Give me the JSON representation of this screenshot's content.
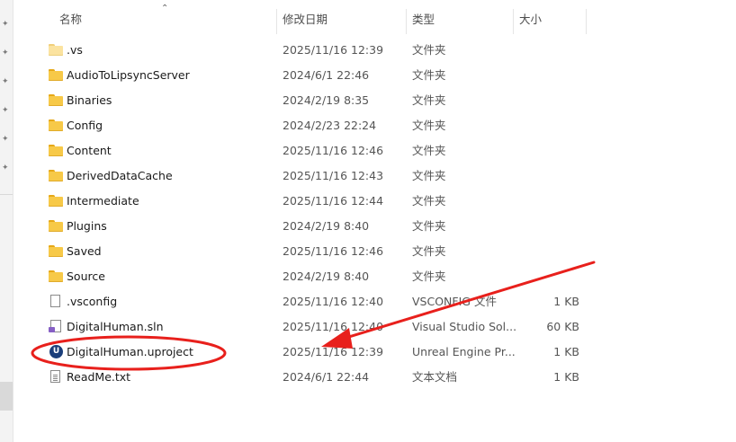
{
  "columns": {
    "name": "名称",
    "date": "修改日期",
    "type": "类型",
    "size": "大小"
  },
  "files": [
    {
      "name": ".vs",
      "date": "2025/11/16 12:39",
      "type": "文件夹",
      "size": "",
      "icon": "folder-icon",
      "pale": true
    },
    {
      "name": "AudioToLipsyncServer",
      "date": "2024/6/1 22:46",
      "type": "文件夹",
      "size": "",
      "icon": "folder-icon"
    },
    {
      "name": "Binaries",
      "date": "2024/2/19 8:35",
      "type": "文件夹",
      "size": "",
      "icon": "folder-icon"
    },
    {
      "name": "Config",
      "date": "2024/2/23 22:24",
      "type": "文件夹",
      "size": "",
      "icon": "folder-icon"
    },
    {
      "name": "Content",
      "date": "2025/11/16 12:46",
      "type": "文件夹",
      "size": "",
      "icon": "folder-icon"
    },
    {
      "name": "DerivedDataCache",
      "date": "2025/11/16 12:43",
      "type": "文件夹",
      "size": "",
      "icon": "folder-icon"
    },
    {
      "name": "Intermediate",
      "date": "2025/11/16 12:44",
      "type": "文件夹",
      "size": "",
      "icon": "folder-icon"
    },
    {
      "name": "Plugins",
      "date": "2024/2/19 8:40",
      "type": "文件夹",
      "size": "",
      "icon": "folder-icon"
    },
    {
      "name": "Saved",
      "date": "2025/11/16 12:46",
      "type": "文件夹",
      "size": "",
      "icon": "folder-icon"
    },
    {
      "name": "Source",
      "date": "2024/2/19 8:40",
      "type": "文件夹",
      "size": "",
      "icon": "folder-icon"
    },
    {
      "name": ".vsconfig",
      "date": "2025/11/16 12:40",
      "type": "VSCONFIG 文件",
      "size": "1 KB",
      "icon": "file-icon"
    },
    {
      "name": "DigitalHuman.sln",
      "date": "2025/11/16 12:40",
      "type": "Visual Studio Sol...",
      "size": "60 KB",
      "icon": "sln-icon"
    },
    {
      "name": "DigitalHuman.uproject",
      "date": "2025/11/16 12:39",
      "type": "Unreal Engine Pr...",
      "size": "1 KB",
      "icon": "unreal-engine-icon"
    },
    {
      "name": "ReadMe.txt",
      "date": "2024/6/1 22:44",
      "type": "文本文档",
      "size": "1 KB",
      "icon": "text-file-icon"
    }
  ],
  "colors": {
    "annotation": "#e8201c",
    "folder": "#f7c948"
  }
}
